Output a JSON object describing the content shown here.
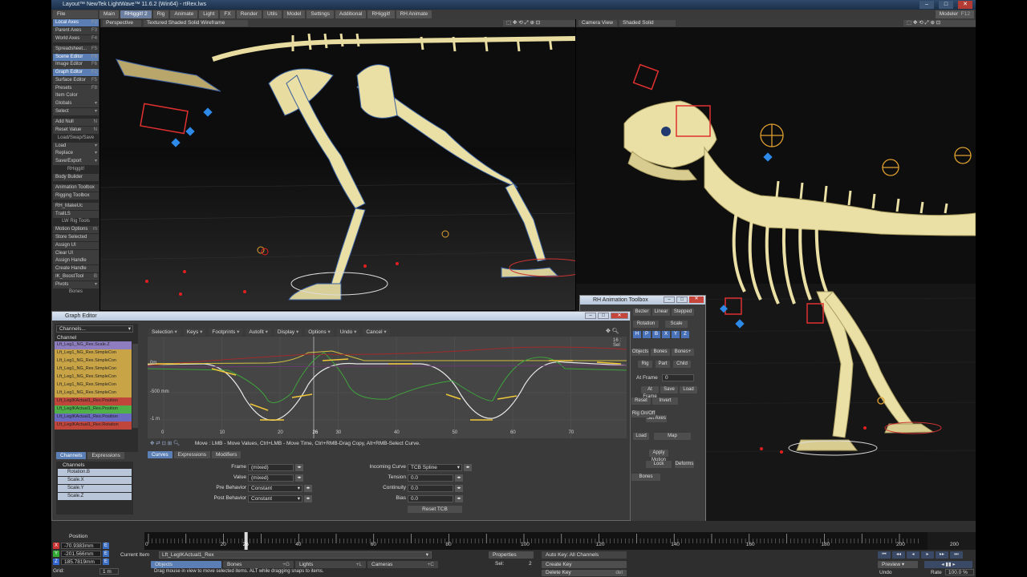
{
  "window": {
    "title": "Layout™ NewTek LightWave™ 11.6.2 (Win64) - rtRex.lws",
    "modeler": "Modeler",
    "f12": "F12"
  },
  "menu_tabs": [
    "Main",
    "RHiggit! 2",
    "Rig",
    "Animate",
    "Light",
    "FX",
    "Render",
    "Utils",
    "Model",
    "Settings",
    "Additional",
    "RHiggit!",
    "RH Animate"
  ],
  "active_tab": "RHiggit! 2",
  "toolbar": {
    "file": "File",
    "items": [
      {
        "label": "Local Axes",
        "key": "F2",
        "hl": true
      },
      {
        "label": "Parent Axes",
        "key": "F3"
      },
      {
        "label": "World Axes",
        "key": "F4"
      },
      {
        "label": "Spreadsheet...",
        "key": "F5",
        "gap": true
      },
      {
        "label": "Scene Editor",
        "key": "F6",
        "hl": true
      },
      {
        "label": "Image Editor",
        "key": "F6"
      },
      {
        "label": "Graph Editor",
        "key": "F2",
        "hl": true
      },
      {
        "label": "Surface Editor",
        "key": "F5"
      },
      {
        "label": "Presets",
        "key": "F8"
      },
      {
        "label": "Item Color",
        "key": ""
      },
      {
        "label": "Globals",
        "key": "▾"
      },
      {
        "label": "Select",
        "key": "▾"
      },
      {
        "label": "Add Null",
        "key": "N",
        "gap": true
      },
      {
        "label": "Reset Value",
        "key": "N"
      },
      {
        "label": "Load/Swap/Save",
        "key": "",
        "head": true
      },
      {
        "label": "Load",
        "key": "▾"
      },
      {
        "label": "Replace",
        "key": "▾"
      },
      {
        "label": "Save/Export",
        "key": "▾"
      },
      {
        "label": "RHiggit!",
        "key": "",
        "head": true
      },
      {
        "label": "Body Builder",
        "key": ""
      },
      {
        "label": "Animation Toolbox",
        "key": "",
        "gap": true
      },
      {
        "label": "Rigging Toolbox",
        "key": ""
      },
      {
        "label": "RH_MakeUc",
        "key": "",
        "gap": true
      },
      {
        "label": "TrailLS",
        "key": ""
      },
      {
        "label": "LW Rig Tools",
        "key": "",
        "head": true
      },
      {
        "label": "Motion Options",
        "key": "m"
      },
      {
        "label": "Store Selected",
        "key": ""
      },
      {
        "label": "Assign UI",
        "key": ""
      },
      {
        "label": "Clear UI",
        "key": ""
      },
      {
        "label": "Assign Handle",
        "key": ""
      },
      {
        "label": "Create Handle",
        "key": ""
      },
      {
        "label": "IK_BoostTool",
        "key": "B"
      },
      {
        "label": "Pivots",
        "key": "▾"
      },
      {
        "label": "Bones",
        "key": "",
        "head": true
      }
    ]
  },
  "viewport_left": {
    "view": "Perspective",
    "shading": "Textured Shaded Solid Wireframe"
  },
  "viewport_right": {
    "view": "Camera View",
    "shading": "Shaded Solid"
  },
  "graph_editor": {
    "title": "Graph Editor",
    "channels_dropdown": "Channels...",
    "channel_header": "Channel",
    "channels": [
      {
        "name": "Lft_Leg1_NG_Rex.Scale.Z",
        "color": "#8e7ec0"
      },
      {
        "name": "Lft_Leg1_NG_Rex.SimpleCon",
        "color": "#c8a446"
      },
      {
        "name": "Lft_Leg1_NG_Rex.SimpleCon",
        "color": "#c8a446"
      },
      {
        "name": "Lft_Leg1_NG_Rex.SimpleCon",
        "color": "#c8a446"
      },
      {
        "name": "Lft_Leg1_NG_Rex.SimpleCon",
        "color": "#c8a446"
      },
      {
        "name": "Lft_Leg1_NG_Rex.SimpleCon",
        "color": "#c8a446"
      },
      {
        "name": "Lft_Leg1_NG_Rex.SimpleCon",
        "color": "#c8a446"
      },
      {
        "name": "Lft_LegIKActual1_Rex.Position",
        "color": "#c0463c"
      },
      {
        "name": "Lft_LegIKActual1_Rex.Position",
        "color": "#4fb04a"
      },
      {
        "name": "Lft_LegIKActual1_Rex.Position",
        "color": "#6a6ac0"
      },
      {
        "name": "Lft_LegIKActual1_Rex.Rotation",
        "color": "#c0463c"
      }
    ],
    "toolbar": [
      "Selection",
      "Keys",
      "Footprints",
      "Autofit",
      "Display",
      "Options",
      "Undo",
      "Cancel"
    ],
    "undo_key": "z",
    "cancel_key": "+U",
    "sel_label": "16 : Sel",
    "y_labels": [
      "0m",
      "-500 mm",
      "-1 m"
    ],
    "x_ticks": [
      "0",
      "10",
      "20",
      "26",
      "30",
      "40",
      "50",
      "60",
      "70"
    ],
    "current_frame": "26",
    "status_line": "Move : LMB - Move Values, Ctrl+LMB - Move Time, Ctrl+RMB-Drag Copy, Alt+RMB-Select Curve.",
    "left_tabs": [
      "Channels",
      "Expressions"
    ],
    "channels_title": "Channels",
    "channel_list": [
      "Rotation.B",
      "Scale.X",
      "Scale.Y",
      "Scale.Z"
    ],
    "bottom_tabs": [
      "Curves",
      "Expressions",
      "Modifiers"
    ],
    "props": {
      "frame_label": "Frame",
      "frame_value": "(mixed)",
      "value_label": "Value",
      "value_value": "(mixed)",
      "pre_label": "Pre Behavior",
      "pre_value": "Constant",
      "post_label": "Post Behavior",
      "post_value": "Constant",
      "incoming_label": "Incoming Curve",
      "incoming_value": "TCB Spline",
      "tension_label": "Tension",
      "tension_value": "0.0",
      "continuity_label": "Continuity",
      "continuity_value": "0.0",
      "bias_label": "Bias",
      "bias_value": "0.0",
      "reset_tcb": "Reset TCB"
    }
  },
  "rh_toolbox": {
    "title": "RH Animation Toolbox",
    "buttons": [
      "Bezier",
      "Linear",
      "Stepped",
      "Rotation",
      "Scale",
      "Objects",
      "Bones",
      "Bones+",
      "Rig",
      "Part",
      "Child",
      "At Frame",
      "Save",
      "Load",
      "Reset",
      "Invert",
      "Set Axes",
      "Load",
      "Map",
      "Apply Motion",
      "Lock",
      "Deforms",
      "Bones",
      "Rig On/Off",
      "KeyFrame"
    ],
    "at_frame_value": "0",
    "axis_buttons": [
      "H",
      "P",
      "B",
      "X",
      "Y",
      "Z"
    ]
  },
  "timeline": {
    "position_label": "Position",
    "x": "-70.9383mm",
    "y": "-201.566mm",
    "z": "185.7819mm",
    "grid_label": "Grid:",
    "grid_value": "1 m",
    "ticks": [
      "0",
      "20",
      "26",
      "40",
      "60",
      "80",
      "100",
      "120",
      "140",
      "160",
      "180",
      "200"
    ],
    "current": "26",
    "end_frame": "200",
    "current_item_label": "Current Item",
    "current_item": "Lft_LegIKActual1_Rex",
    "objects": "Objects",
    "bones": "Bones",
    "lights": "Lights",
    "cameras": "Cameras",
    "bones_key": "+G",
    "lights_key": "+L",
    "cameras_key": "+C",
    "properties": "Properties",
    "sel_label": "Sel:",
    "sel_value": "2",
    "auto_key": "Auto Key: All Channels",
    "create_key": "Create Key",
    "delete_key": "Delete Key",
    "del": "del",
    "hint": "Drag mouse in view to move selected items. ALT while dragging snaps to items.",
    "preview": "Preview",
    "rate_label": "Rate",
    "rate_value": "100.0 %",
    "undo": "Undo",
    "redo": "Redo"
  }
}
